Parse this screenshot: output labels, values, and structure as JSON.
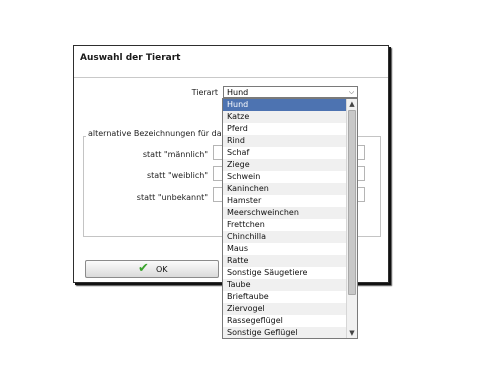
{
  "dialog": {
    "title": "Auswahl der Tierart",
    "species_label": "Tierart",
    "species_selected": "Hund",
    "alt_names_legend": "alternative Bezeichnungen für das Ges",
    "rows": [
      {
        "label": "statt \"männlich\""
      },
      {
        "label": "statt \"weiblich\""
      },
      {
        "label": "statt \"unbekannt\""
      }
    ],
    "ok_label": "OK"
  },
  "dropdown": {
    "selected_index": 0,
    "options": [
      "Hund",
      "Katze",
      "Pferd",
      "Rind",
      "Schaf",
      "Ziege",
      "Schwein",
      "Kaninchen",
      "Hamster",
      "Meerschweinchen",
      "Frettchen",
      "Chinchilla",
      "Maus",
      "Ratte",
      "Sonstige Säugetiere",
      "Taube",
      "Brieftaube",
      "Ziervogel",
      "Rassegeflügel",
      "Sonstige Geflügel"
    ]
  },
  "colors": {
    "selected_bg": "#4d73b1",
    "check_green": "#3aa42c"
  },
  "icons": {
    "select_arrow": "chevron-down-icon",
    "ok_icon": "checkmark-icon",
    "scroll_up": "scroll-up-icon",
    "scroll_down": "scroll-down-icon"
  }
}
